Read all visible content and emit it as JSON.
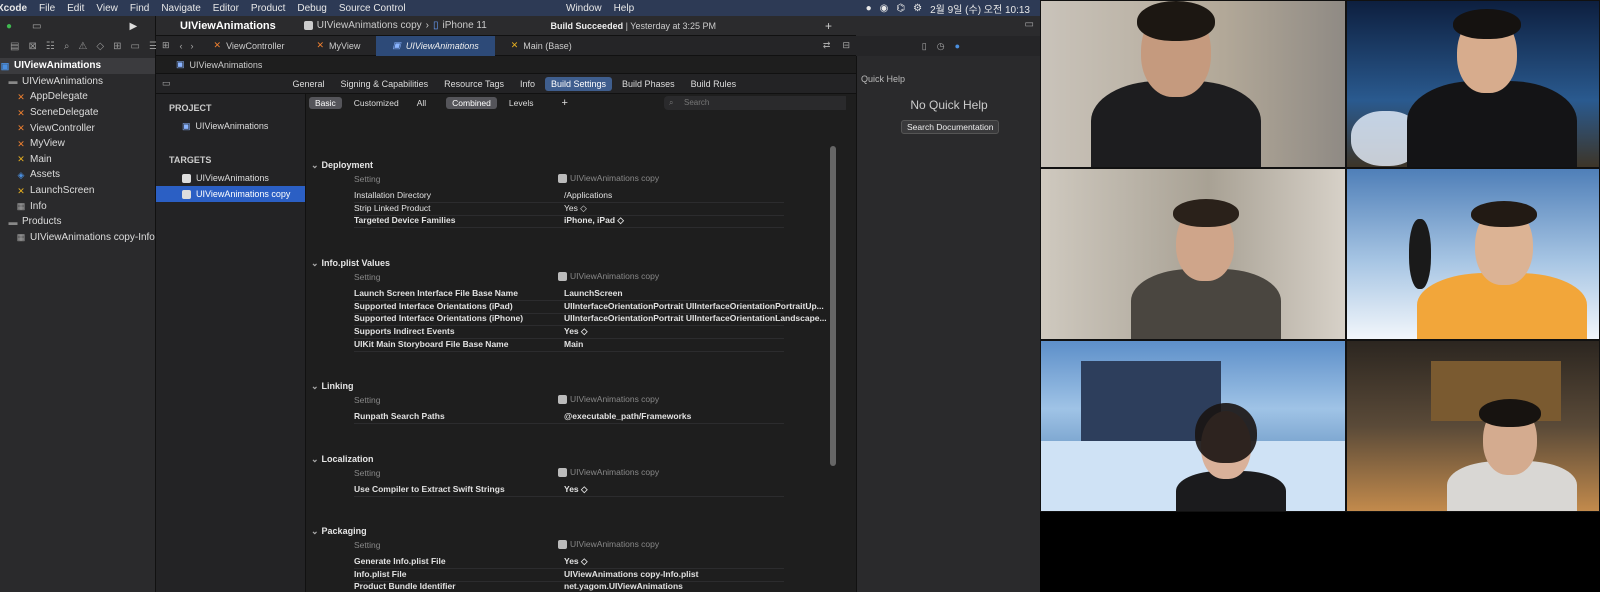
{
  "menubar": {
    "app": "Xcode",
    "items": [
      "File",
      "Edit",
      "View",
      "Find",
      "Navigate",
      "Editor",
      "Product",
      "Debug",
      "Source Control"
    ],
    "items_right": [
      "Window",
      "Help"
    ],
    "clock": "2월 9일 (수) 오전  10:13"
  },
  "toolbar": {
    "project_title": "UIViewAnimations",
    "scheme": "UIViewAnimations copy",
    "destination": "iPhone 11",
    "build_result": "Build Succeeded",
    "build_time": "Yesterday at 3:25 PM",
    "add_label": "+"
  },
  "navigator": {
    "items": [
      {
        "label": "UIViewAnimations",
        "icon": "project-icon",
        "selected": true
      },
      {
        "label": "UIViewAnimations",
        "icon": "folder-icon"
      },
      {
        "label": "AppDelegate",
        "icon": "swift-file-icon"
      },
      {
        "label": "SceneDelegate",
        "icon": "swift-file-icon"
      },
      {
        "label": "ViewController",
        "icon": "swift-file-icon"
      },
      {
        "label": "MyView",
        "icon": "swift-file-icon"
      },
      {
        "label": "Main",
        "icon": "storyboard-icon"
      },
      {
        "label": "Assets",
        "icon": "asset-catalog-icon"
      },
      {
        "label": "LaunchScreen",
        "icon": "storyboard-icon"
      },
      {
        "label": "Info",
        "icon": "plist-icon"
      },
      {
        "label": "Products",
        "icon": "folder-icon"
      },
      {
        "label": "UIViewAnimations copy-Info",
        "icon": "plist-icon"
      }
    ]
  },
  "editor_tabs": [
    "ViewController",
    "MyView",
    "UIViewAnimations",
    "Main (Base)"
  ],
  "breadcrumb": "UIViewAnimations",
  "settings_tabs": [
    "General",
    "Signing & Capabilities",
    "Resource Tags",
    "Info",
    "Build Settings",
    "Build Phases",
    "Build Rules"
  ],
  "targets_panel": {
    "project_header": "PROJECT",
    "project_item": "UIViewAnimations",
    "targets_header": "TARGETS",
    "targets": [
      "UIViewAnimations",
      "UIViewAnimations copy"
    ]
  },
  "filters": {
    "basic": "Basic",
    "customized": "Customized",
    "all": "All",
    "combined": "Combined",
    "levels": "Levels",
    "add": "+",
    "search_placeholder": "Search"
  },
  "build_settings": {
    "setting_header": "Setting",
    "target_header": "UIViewAnimations copy",
    "sections": [
      {
        "title": "Deployment",
        "rows": [
          {
            "name": "Installation Directory",
            "value": "/Applications"
          },
          {
            "name": "Strip Linked Product",
            "value": "Yes ◇"
          },
          {
            "name": "Targeted Device Families",
            "value": "iPhone, iPad ◇"
          }
        ]
      },
      {
        "title": "Info.plist Values",
        "rows": [
          {
            "name": "Launch Screen Interface File Base Name",
            "value": "LaunchScreen"
          },
          {
            "name": "Supported Interface Orientations (iPad)",
            "value": "UIInterfaceOrientationPortrait UIInterfaceOrientationPortraitUp..."
          },
          {
            "name": "Supported Interface Orientations (iPhone)",
            "value": "UIInterfaceOrientationPortrait UIInterfaceOrientationLandscape..."
          },
          {
            "name": "Supports Indirect Events",
            "value": "Yes ◇"
          },
          {
            "name": "UIKit Main Storyboard File Base Name",
            "value": "Main"
          }
        ]
      },
      {
        "title": "Linking",
        "rows": [
          {
            "name": "Runpath Search Paths",
            "value": "@executable_path/Frameworks"
          }
        ]
      },
      {
        "title": "Localization",
        "rows": [
          {
            "name": "Use Compiler to Extract Swift Strings",
            "value": "Yes ◇"
          }
        ]
      },
      {
        "title": "Packaging",
        "rows": [
          {
            "name": "Generate Info.plist File",
            "value": "Yes ◇"
          },
          {
            "name": "Info.plist File",
            "value": "UIViewAnimations copy-Info.plist"
          },
          {
            "name": "Product Bundle Identifier",
            "value": "net.yagom.UIViewAnimations"
          }
        ]
      }
    ]
  },
  "quick_help": {
    "title": "Quick Help",
    "empty": "No Quick Help",
    "button": "Search Documentation"
  },
  "video_call": {
    "participants": 6,
    "tiles": [
      {
        "bg": "#b7b1a8"
      },
      {
        "bg": "#213d6b"
      },
      {
        "bg": "#a39b8f"
      },
      {
        "bg": "#9cb8d6"
      },
      {
        "bg": "#3c6fa8"
      },
      {
        "bg": "#3b3026"
      }
    ]
  }
}
